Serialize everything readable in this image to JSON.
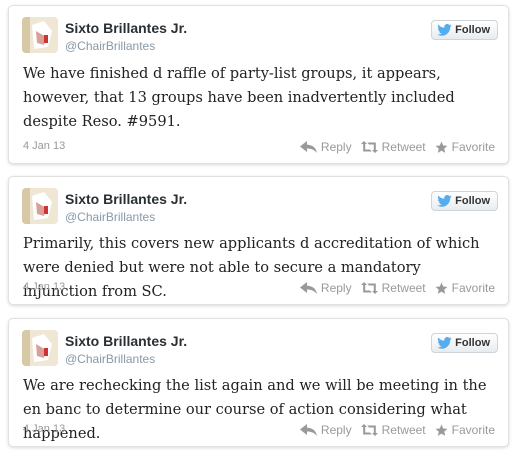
{
  "colors": {
    "brand_blue": "#55acee",
    "muted": "#999999"
  },
  "tweets": [
    {
      "name": "Sixto Brillantes Jr.",
      "handle": "@ChairBrillantes",
      "follow_label": "Follow",
      "text": "We have finished d raffle of party-list groups, it appears, however, that 13 groups have been inadvertently included despite Reso. #9591.",
      "date": "4 Jan 13",
      "reply_label": "Reply",
      "retweet_label": "Retweet",
      "favorite_label": "Favorite"
    },
    {
      "name": "Sixto Brillantes Jr.",
      "handle": "@ChairBrillantes",
      "follow_label": "Follow",
      "text": "Primarily, this covers new applicants d accreditation of which were denied but were not able to secure a mandatory injunction from SC.",
      "date": "4 Jan 13",
      "reply_label": "Reply",
      "retweet_label": "Retweet",
      "favorite_label": "Favorite"
    },
    {
      "name": "Sixto Brillantes Jr.",
      "handle": "@ChairBrillantes",
      "follow_label": "Follow",
      "text": "We are rechecking the list again and we will be meeting in the en banc to determine our course of action considering what happened.",
      "date": "4 Jan 13",
      "reply_label": "Reply",
      "retweet_label": "Retweet",
      "favorite_label": "Favorite"
    }
  ]
}
